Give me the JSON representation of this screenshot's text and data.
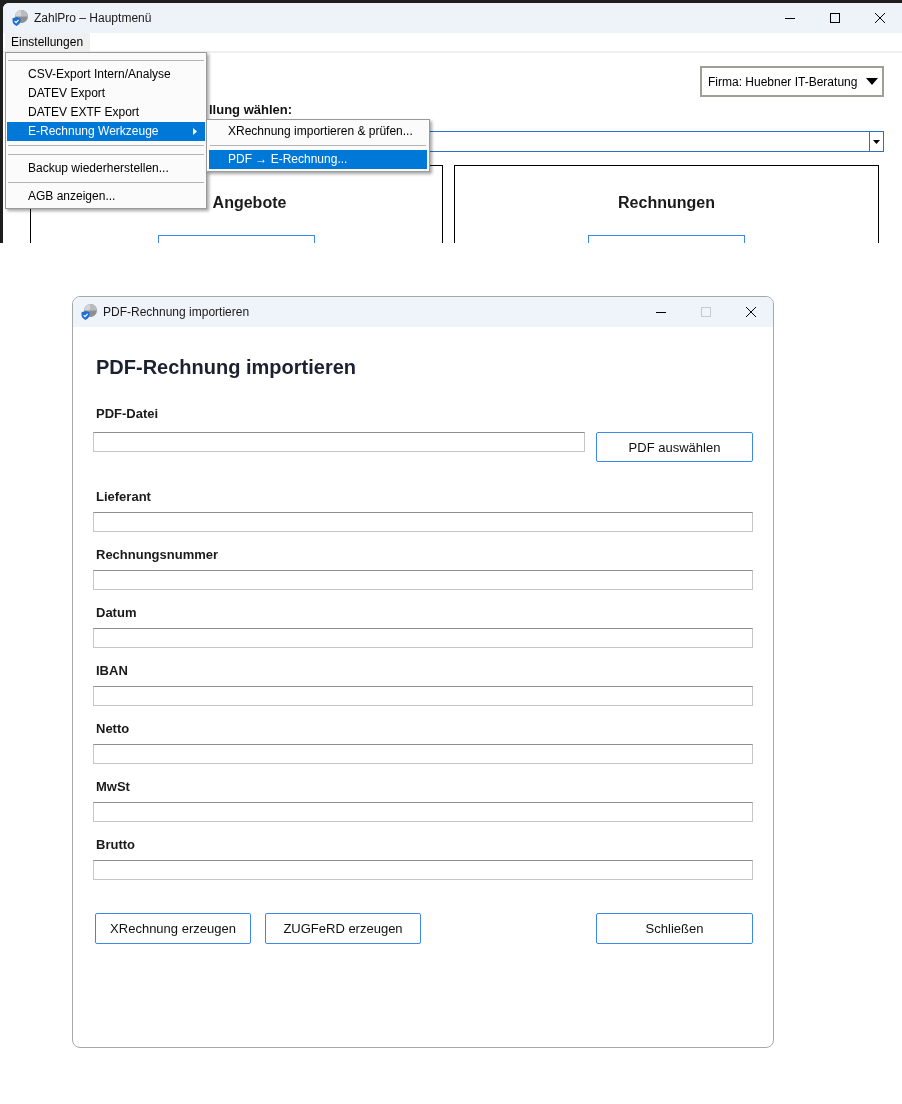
{
  "main_window": {
    "title": "ZahlPro – Hauptmenü",
    "menu_bar": [
      {
        "label": "Einstellungen",
        "selected": true
      }
    ],
    "menu": [
      {
        "kind": "separator"
      },
      {
        "kind": "item",
        "label": "CSV-Export Intern/Analyse",
        "selected": false
      },
      {
        "kind": "item",
        "label": "DATEV Export",
        "selected": false
      },
      {
        "kind": "item",
        "label": "DATEV EXTF Export",
        "selected": false
      },
      {
        "kind": "submenu",
        "label": "E-Rechnung Werkzeuge",
        "selected": true,
        "expanded": true,
        "children": [
          {
            "kind": "item",
            "label": "XRechnung importieren & prüfen...",
            "selected": false
          },
          {
            "kind": "separator"
          },
          {
            "kind": "item",
            "label": "PDF → E-Rechnung...",
            "selected": true
          }
        ]
      },
      {
        "kind": "separator"
      },
      {
        "kind": "separator"
      },
      {
        "kind": "item",
        "label": "Backup wiederherstellen...",
        "selected": false
      },
      {
        "kind": "separator"
      },
      {
        "kind": "item",
        "label": "AGB anzeigen...",
        "selected": false
      }
    ],
    "company_select": {
      "value": "Firma: Huebner IT-Beratung"
    },
    "view_label": "llung wählen:",
    "panels": [
      {
        "title": "Angebote"
      },
      {
        "title": "Rechnungen"
      }
    ]
  },
  "dialog": {
    "title": "PDF-Rechnung importieren",
    "maximize_disabled": true,
    "heading": "PDF-Rechnung importieren",
    "file": {
      "label": "PDF-Datei",
      "button": "PDF auswählen"
    },
    "fields": [
      {
        "label": "Lieferant"
      },
      {
        "label": "Rechnungsnummer"
      },
      {
        "label": "Datum"
      },
      {
        "label": "IBAN"
      },
      {
        "label": "Netto"
      },
      {
        "label": "MwSt"
      },
      {
        "label": "Brutto"
      }
    ],
    "actions": [
      {
        "label": "XRechnung erzeugen"
      },
      {
        "label": "ZUGFeRD erzeugen"
      }
    ],
    "close_button": {
      "label": "Schließen"
    }
  }
}
